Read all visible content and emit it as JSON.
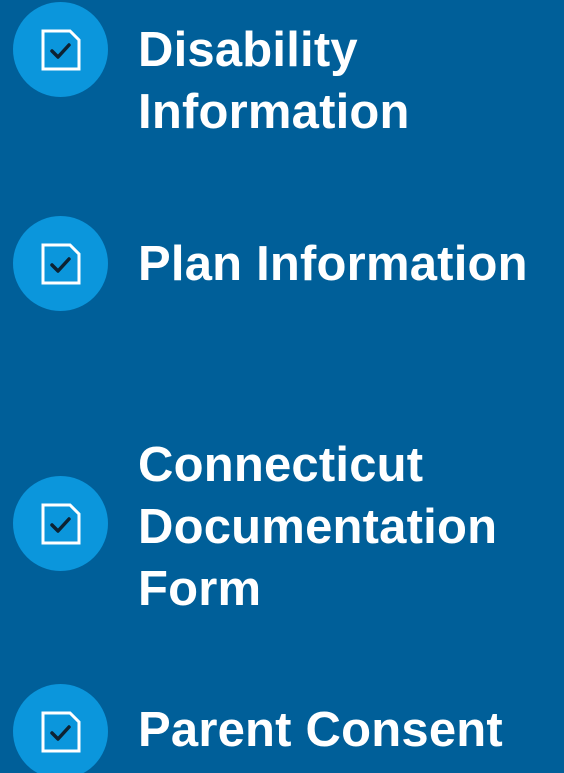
{
  "steps": [
    {
      "label": "Disability\nInformation",
      "icon": "document-check-icon"
    },
    {
      "label": "Plan Information",
      "icon": "document-check-icon"
    },
    {
      "label": "Connecticut\nDocumentation\nForm",
      "icon": "document-check-icon"
    },
    {
      "label": "Parent Consent",
      "icon": "document-check-icon"
    }
  ],
  "colors": {
    "background": "#005f99",
    "badge": "#0b96dc",
    "icon_stroke": "#ffffff",
    "check": "#0d2233",
    "text": "#ffffff"
  }
}
